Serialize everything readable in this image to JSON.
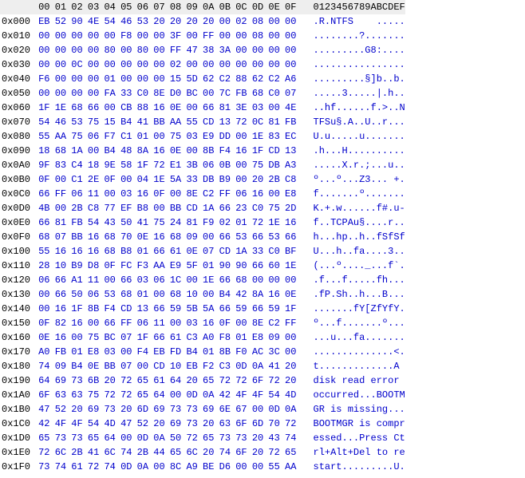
{
  "header": {
    "offset_label": "",
    "hex_cols": [
      "00",
      "01",
      "02",
      "03",
      "04",
      "05",
      "06",
      "07",
      "08",
      "09",
      "0A",
      "0B",
      "0C",
      "0D",
      "0E",
      "0F"
    ],
    "ascii_label": "0123456789ABCDEF"
  },
  "rows": [
    {
      "offset": "0x000",
      "hex": [
        "EB",
        "52",
        "90",
        "4E",
        "54",
        "46",
        "53",
        "20",
        "20",
        "20",
        "20",
        "00",
        "02",
        "08",
        "00",
        "00"
      ],
      "ascii": ".R.NTFS    ....."
    },
    {
      "offset": "0x010",
      "hex": [
        "00",
        "00",
        "00",
        "00",
        "00",
        "F8",
        "00",
        "00",
        "3F",
        "00",
        "FF",
        "00",
        "00",
        "08",
        "00",
        "00"
      ],
      "ascii": "........?......."
    },
    {
      "offset": "0x020",
      "hex": [
        "00",
        "00",
        "00",
        "00",
        "80",
        "00",
        "80",
        "00",
        "FF",
        "47",
        "38",
        "3A",
        "00",
        "00",
        "00",
        "00"
      ],
      "ascii": ".........G8:...."
    },
    {
      "offset": "0x030",
      "hex": [
        "00",
        "00",
        "0C",
        "00",
        "00",
        "00",
        "00",
        "00",
        "02",
        "00",
        "00",
        "00",
        "00",
        "00",
        "00",
        "00"
      ],
      "ascii": "................"
    },
    {
      "offset": "0x040",
      "hex": [
        "F6",
        "00",
        "00",
        "00",
        "01",
        "00",
        "00",
        "00",
        "15",
        "5D",
        "62",
        "C2",
        "88",
        "62",
        "C2",
        "A6"
      ],
      "ascii": ".........§]b..b."
    },
    {
      "offset": "0x050",
      "hex": [
        "00",
        "00",
        "00",
        "00",
        "FA",
        "33",
        "C0",
        "8E",
        "D0",
        "BC",
        "00",
        "7C",
        "FB",
        "68",
        "C0",
        "07"
      ],
      "ascii": ".....3.....|.h.."
    },
    {
      "offset": "0x060",
      "hex": [
        "1F",
        "1E",
        "68",
        "66",
        "00",
        "CB",
        "88",
        "16",
        "0E",
        "00",
        "66",
        "81",
        "3E",
        "03",
        "00",
        "4E"
      ],
      "ascii": "..hf......f.>..N"
    },
    {
      "offset": "0x070",
      "hex": [
        "54",
        "46",
        "53",
        "75",
        "15",
        "B4",
        "41",
        "BB",
        "AA",
        "55",
        "CD",
        "13",
        "72",
        "0C",
        "81",
        "FB"
      ],
      "ascii": "TFSu§.A..U..r..."
    },
    {
      "offset": "0x080",
      "hex": [
        "55",
        "AA",
        "75",
        "06",
        "F7",
        "C1",
        "01",
        "00",
        "75",
        "03",
        "E9",
        "DD",
        "00",
        "1E",
        "83",
        "EC"
      ],
      "ascii": "U.u.....u......."
    },
    {
      "offset": "0x090",
      "hex": [
        "18",
        "68",
        "1A",
        "00",
        "B4",
        "48",
        "8A",
        "16",
        "0E",
        "00",
        "8B",
        "F4",
        "16",
        "1F",
        "CD",
        "13"
      ],
      "ascii": ".h...H.........."
    },
    {
      "offset": "0x0A0",
      "hex": [
        "9F",
        "83",
        "C4",
        "18",
        "9E",
        "58",
        "1F",
        "72",
        "E1",
        "3B",
        "06",
        "0B",
        "00",
        "75",
        "DB",
        "A3"
      ],
      "ascii": ".....X.r.;...u.."
    },
    {
      "offset": "0x0B0",
      "hex": [
        "0F",
        "00",
        "C1",
        "2E",
        "0F",
        "00",
        "04",
        "1E",
        "5A",
        "33",
        "DB",
        "B9",
        "00",
        "20",
        "2B",
        "C8"
      ],
      "ascii": "º...º...Z3... +."
    },
    {
      "offset": "0x0C0",
      "hex": [
        "66",
        "FF",
        "06",
        "11",
        "00",
        "03",
        "16",
        "0F",
        "00",
        "8E",
        "C2",
        "FF",
        "06",
        "16",
        "00",
        "E8"
      ],
      "ascii": "f.......º......."
    },
    {
      "offset": "0x0D0",
      "hex": [
        "4B",
        "00",
        "2B",
        "C8",
        "77",
        "EF",
        "B8",
        "00",
        "BB",
        "CD",
        "1A",
        "66",
        "23",
        "C0",
        "75",
        "2D"
      ],
      "ascii": "K.+.w......f#.u-"
    },
    {
      "offset": "0x0E0",
      "hex": [
        "66",
        "81",
        "FB",
        "54",
        "43",
        "50",
        "41",
        "75",
        "24",
        "81",
        "F9",
        "02",
        "01",
        "72",
        "1E",
        "16"
      ],
      "ascii": "f..TCPAu§....r.."
    },
    {
      "offset": "0x0F0",
      "hex": [
        "68",
        "07",
        "BB",
        "16",
        "68",
        "70",
        "0E",
        "16",
        "68",
        "09",
        "00",
        "66",
        "53",
        "66",
        "53",
        "66"
      ],
      "ascii": "h...hp..h..fSfSf"
    },
    {
      "offset": "0x100",
      "hex": [
        "55",
        "16",
        "16",
        "16",
        "68",
        "B8",
        "01",
        "66",
        "61",
        "0E",
        "07",
        "CD",
        "1A",
        "33",
        "C0",
        "BF"
      ],
      "ascii": "U...h..fa....3.."
    },
    {
      "offset": "0x110",
      "hex": [
        "28",
        "10",
        "B9",
        "D8",
        "0F",
        "FC",
        "F3",
        "AA",
        "E9",
        "5F",
        "01",
        "90",
        "90",
        "66",
        "60",
        "1E"
      ],
      "ascii": "(...º...._...f`."
    },
    {
      "offset": "0x120",
      "hex": [
        "06",
        "66",
        "A1",
        "11",
        "00",
        "66",
        "03",
        "06",
        "1C",
        "00",
        "1E",
        "66",
        "68",
        "00",
        "00",
        "00"
      ],
      "ascii": ".f...f.....fh..."
    },
    {
      "offset": "0x130",
      "hex": [
        "00",
        "66",
        "50",
        "06",
        "53",
        "68",
        "01",
        "00",
        "68",
        "10",
        "00",
        "B4",
        "42",
        "8A",
        "16",
        "0E"
      ],
      "ascii": ".fP.Sh..h...B..."
    },
    {
      "offset": "0x140",
      "hex": [
        "00",
        "16",
        "1F",
        "8B",
        "F4",
        "CD",
        "13",
        "66",
        "59",
        "5B",
        "5A",
        "66",
        "59",
        "66",
        "59",
        "1F"
      ],
      "ascii": ".......fY[ZfYfY."
    },
    {
      "offset": "0x150",
      "hex": [
        "0F",
        "82",
        "16",
        "00",
        "66",
        "FF",
        "06",
        "11",
        "00",
        "03",
        "16",
        "0F",
        "00",
        "8E",
        "C2",
        "FF"
      ],
      "ascii": "º...f.......º..."
    },
    {
      "offset": "0x160",
      "hex": [
        "0E",
        "16",
        "00",
        "75",
        "BC",
        "07",
        "1F",
        "66",
        "61",
        "C3",
        "A0",
        "F8",
        "01",
        "E8",
        "09",
        "00"
      ],
      "ascii": "...u...fa......."
    },
    {
      "offset": "0x170",
      "hex": [
        "A0",
        "FB",
        "01",
        "E8",
        "03",
        "00",
        "F4",
        "EB",
        "FD",
        "B4",
        "01",
        "8B",
        "F0",
        "AC",
        "3C",
        "00"
      ],
      "ascii": "..............<."
    },
    {
      "offset": "0x180",
      "hex": [
        "74",
        "09",
        "B4",
        "0E",
        "BB",
        "07",
        "00",
        "CD",
        "10",
        "EB",
        "F2",
        "C3",
        "0D",
        "0A",
        "41",
        "20"
      ],
      "ascii": "t.............A "
    },
    {
      "offset": "0x190",
      "hex": [
        "64",
        "69",
        "73",
        "6B",
        "20",
        "72",
        "65",
        "61",
        "64",
        "20",
        "65",
        "72",
        "72",
        "6F",
        "72",
        "20"
      ],
      "ascii": "disk read error "
    },
    {
      "offset": "0x1A0",
      "hex": [
        "6F",
        "63",
        "63",
        "75",
        "72",
        "72",
        "65",
        "64",
        "00",
        "0D",
        "0A",
        "42",
        "4F",
        "4F",
        "54",
        "4D"
      ],
      "ascii": "occurred...BOOTM"
    },
    {
      "offset": "0x1B0",
      "hex": [
        "47",
        "52",
        "20",
        "69",
        "73",
        "20",
        "6D",
        "69",
        "73",
        "73",
        "69",
        "6E",
        "67",
        "00",
        "0D",
        "0A"
      ],
      "ascii": "GR is missing..."
    },
    {
      "offset": "0x1C0",
      "hex": [
        "42",
        "4F",
        "4F",
        "54",
        "4D",
        "47",
        "52",
        "20",
        "69",
        "73",
        "20",
        "63",
        "6F",
        "6D",
        "70",
        "72"
      ],
      "ascii": "BOOTMGR is compr"
    },
    {
      "offset": "0x1D0",
      "hex": [
        "65",
        "73",
        "73",
        "65",
        "64",
        "00",
        "0D",
        "0A",
        "50",
        "72",
        "65",
        "73",
        "73",
        "20",
        "43",
        "74"
      ],
      "ascii": "essed...Press Ct"
    },
    {
      "offset": "0x1E0",
      "hex": [
        "72",
        "6C",
        "2B",
        "41",
        "6C",
        "74",
        "2B",
        "44",
        "65",
        "6C",
        "20",
        "74",
        "6F",
        "20",
        "72",
        "65"
      ],
      "ascii": "rl+Alt+Del to re"
    },
    {
      "offset": "0x1F0",
      "hex": [
        "73",
        "74",
        "61",
        "72",
        "74",
        "0D",
        "0A",
        "00",
        "8C",
        "A9",
        "BE",
        "D6",
        "00",
        "00",
        "55",
        "AA"
      ],
      "ascii": "start.........U."
    }
  ]
}
